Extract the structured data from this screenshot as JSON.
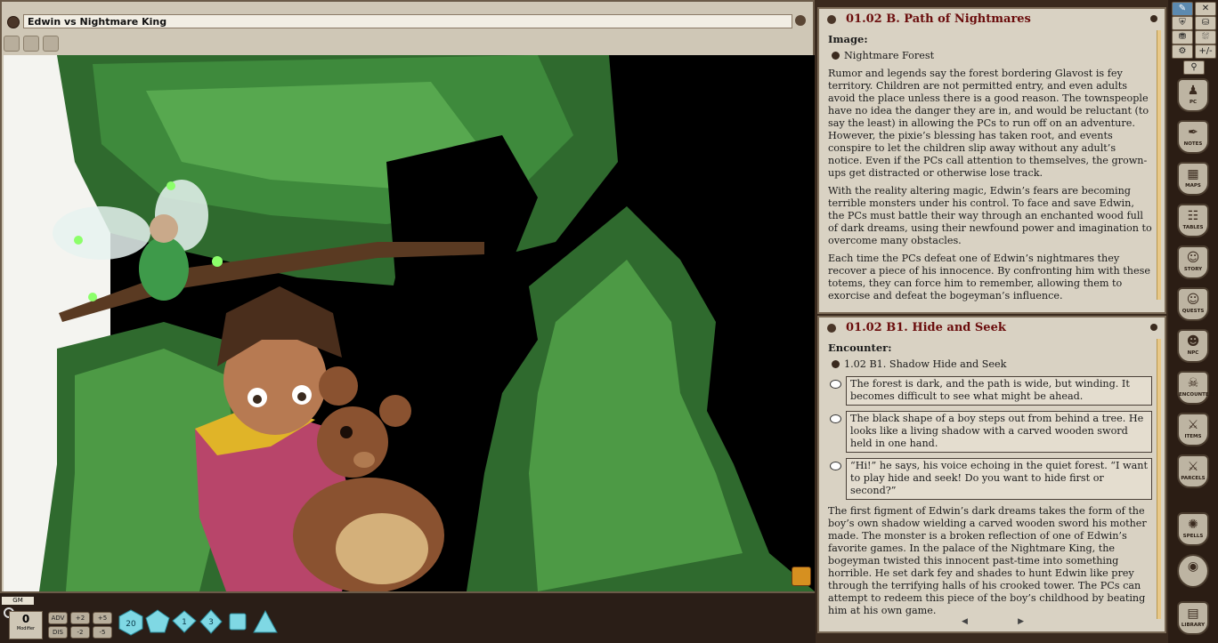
{
  "image_window": {
    "title": "Edwin vs Nightmare King"
  },
  "panel_a": {
    "title": "01.02 B. Path of Nightmares",
    "subhead": "Image:",
    "link": "Nightmare Forest",
    "paragraphs": [
      "Rumor and legends say the forest bordering Glavost is fey territory. Children are not permitted entry, and even adults avoid the place unless there is a good reason. The townspeople have no idea the danger they are in, and would be reluctant (to say the least) in allowing the PCs to run off on an adventure. However, the pixie’s blessing has taken root, and events conspire to let the children slip away without any adult’s notice. Even if the PCs call attention to themselves, the grown-ups get distracted or otherwise lose track.",
      "With the reality altering magic, Edwin’s fears are becoming terrible monsters under his control. To face and save Edwin, the PCs must battle their way through an enchanted wood full of dark dreams, using their newfound power and imagination to overcome many obstacles.",
      "Each time the PCs defeat one of Edwin’s nightmares they recover a piece of his innocence. By confronting him with these totems, they can force him to remember, allowing them to exorcise and defeat the bogeyman’s influence."
    ]
  },
  "panel_b": {
    "title": "01.02 B1. Hide and Seek",
    "subhead": "Encounter:",
    "link": "1.02 B1. Shadow Hide and Seek",
    "read_aloud": [
      "The forest is dark, and the path is wide, but winding. It becomes difficult to see what might be ahead.",
      "The black shape of a boy steps out from behind a tree. He looks like a living shadow with a carved wooden sword held in one hand.",
      "“Hi!” he says, his voice echoing in the quiet forest. “I want to play hide and seek! Do you want to hide first or second?”"
    ],
    "paragraph": "The first figment of Edwin’s dark dreams takes the form of the boy’s own shadow wielding a carved wooden sword his mother made. The monster is a broken reflection of one of Edwin’s favorite games. In the palace of the Nightmare King, the bogeyman twisted this innocent past-time into something horrible. He set dark fey and shades to hunt Edwin like prey through the terrifying halls of his crooked tower. The PCs can attempt to redeem this piece of the boy’s childhood by beating him at his own game.",
    "pager_prev": "◀",
    "pager_next": "▶"
  },
  "sidebar": {
    "top_buttons": [
      "✎",
      "✕",
      "⛨",
      "⛁",
      "⛃",
      "⛆",
      "⚙",
      "+/-",
      "⚲"
    ],
    "shields": [
      "PC",
      "NOTES",
      "MAPS",
      "TABLES",
      "STORY",
      "QUESTS",
      "NPC",
      "ENCOUNTERS",
      "ITEMS",
      "PARCELS",
      "SPELLS",
      "",
      "LIBRARY"
    ]
  },
  "bottom_bar": {
    "gm_label": "GM",
    "modifier_value": "0",
    "modifier_label": "Modifier",
    "mod_buttons": [
      "ADV",
      "+2",
      "+5",
      "DIS",
      "-2",
      "-5"
    ],
    "dice": [
      "d20",
      "d12",
      "d10",
      "d8",
      "d6",
      "d4"
    ],
    "dice_labels": [
      "20",
      "",
      "1",
      "3",
      "",
      ""
    ]
  }
}
